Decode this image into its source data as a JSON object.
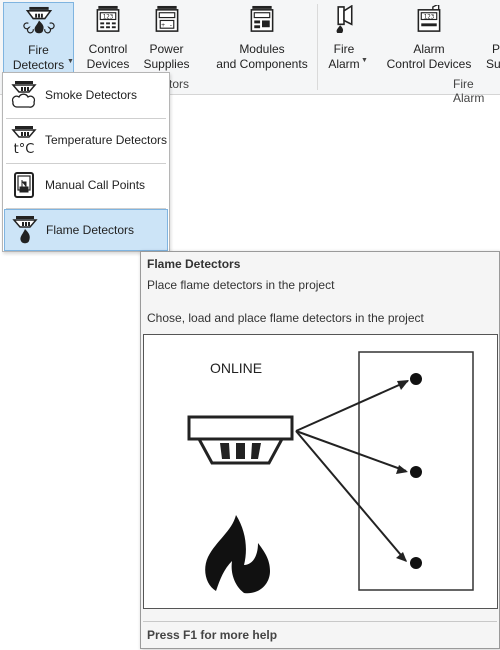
{
  "ribbon": {
    "buttons": [
      {
        "line1": "Fire",
        "line2": "Detectors",
        "icon": "fire-detector-icon",
        "active": true
      },
      {
        "line1": "Control",
        "line2": "Devices",
        "icon": "control-device-icon"
      },
      {
        "line1": "Power",
        "line2": "Supplies",
        "icon": "power-supply-icon"
      },
      {
        "line1": "Modules",
        "line2": "and Components",
        "icon": "module-icon"
      },
      {
        "line1": "Fire",
        "line2": "Alarm",
        "icon": "fire-alarm-icon"
      },
      {
        "line1": "Alarm",
        "line2": "Control Devices",
        "icon": "alarm-control-device-icon"
      },
      {
        "line1": "P",
        "line2": "Su",
        "icon": "partial-button-icon"
      }
    ],
    "groups": [
      {
        "label": "ctors"
      },
      {
        "label": "Fire Alarm"
      }
    ]
  },
  "menu": {
    "items": [
      {
        "label": "Smoke Detectors",
        "icon": "smoke-detector-icon"
      },
      {
        "label": "Temperature Detectors",
        "icon": "temperature-detector-icon"
      },
      {
        "label": "Manual Call Points",
        "icon": "manual-call-point-icon"
      },
      {
        "label": "Flame Detectors",
        "icon": "flame-detector-icon",
        "selected": true
      }
    ]
  },
  "tooltip": {
    "title": "Flame Detectors",
    "description": "Place flame detectors in the project",
    "long_description": "Chose, load and place flame detectors in the project",
    "figure_label": "ONLINE",
    "help": "Press F1 for more help"
  }
}
